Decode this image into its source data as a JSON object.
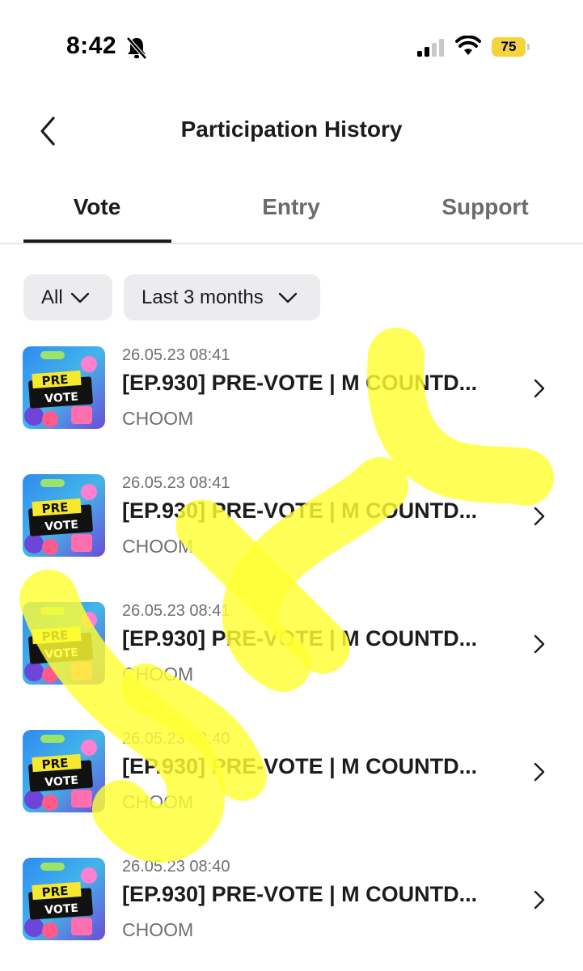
{
  "status_bar": {
    "time": "8:42",
    "battery": "75",
    "icons": [
      "bell-slash-icon",
      "cellular-signal-icon",
      "wifi-icon",
      "battery-icon"
    ],
    "battery_color": "#f5d33b"
  },
  "nav": {
    "title": "Participation History",
    "back_icon": "chevron-left-icon"
  },
  "tabs": [
    {
      "label": "Vote",
      "active": true
    },
    {
      "label": "Entry",
      "active": false
    },
    {
      "label": "Support",
      "active": false
    }
  ],
  "filters": {
    "type": "All",
    "period": "Last 3 months"
  },
  "items": [
    {
      "date": "26.05.23 08:41",
      "title": "[EP.930] PRE-VOTE | M COUNTD...",
      "subtitle": "CHOOM",
      "thumb_line1": "PRE",
      "thumb_line2": "VOTE"
    },
    {
      "date": "26.05.23 08:41",
      "title": "[EP.930] PRE-VOTE | M COUNTD...",
      "subtitle": "CHOOM",
      "thumb_line1": "PRE",
      "thumb_line2": "VOTE"
    },
    {
      "date": "26.05.23 08:41",
      "title": "[EP.930] PRE-VOTE | M COUNTD...",
      "subtitle": "CHOOM",
      "thumb_line1": "PRE",
      "thumb_line2": "VOTE"
    },
    {
      "date": "26.05.23 08:40",
      "title": "[EP.930] PRE-VOTE | M COUNTD...",
      "subtitle": "CHOOM",
      "thumb_line1": "PRE",
      "thumb_line2": "VOTE"
    },
    {
      "date": "26.05.23 08:40",
      "title": "[EP.930] PRE-VOTE | M COUNTD...",
      "subtitle": "CHOOM",
      "thumb_line1": "PRE",
      "thumb_line2": "VOTE"
    }
  ],
  "colors": {
    "text_primary": "#1c1c1e",
    "text_secondary": "#6e6e73",
    "filter_bg": "#ececee",
    "highlighter": "#ffff33"
  }
}
